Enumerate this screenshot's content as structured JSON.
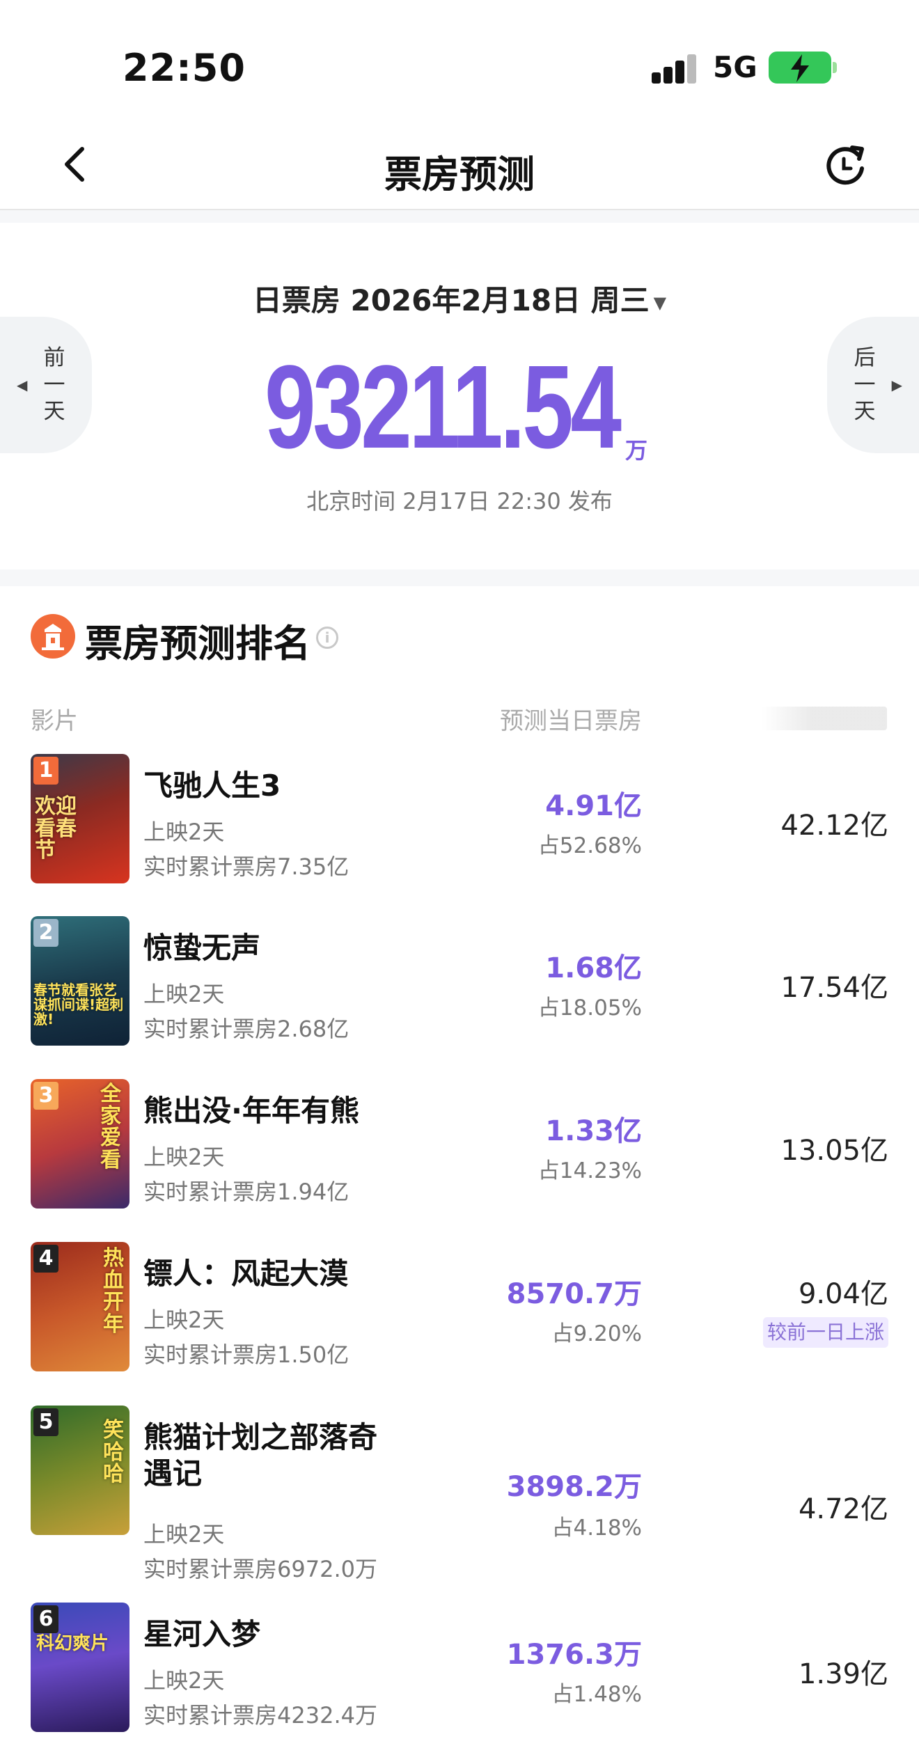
{
  "status_bar": {
    "time": "22:50",
    "network": "5G"
  },
  "nav": {
    "title": "票房预测"
  },
  "summary": {
    "date_label": "日票房 2026年2月18日 周三",
    "amount": "93211.54",
    "unit": "万",
    "publish_note": "北京时间 2月17日 22:30 发布",
    "prev_day_label": "前\n一\n天",
    "next_day_label": "后\n一\n天"
  },
  "ranking": {
    "title": "票房预测排名",
    "columns": {
      "film": "影片",
      "predicted": "预测当日票房"
    },
    "movies": [
      {
        "rank": "1",
        "title": "飞驰人生3",
        "days": "上映2天",
        "total": "实时累计票房7.35亿",
        "predicted": "4.91亿",
        "share": "占52.68%",
        "third": "42.12亿",
        "tag": ""
      },
      {
        "rank": "2",
        "title": "惊蛰无声",
        "days": "上映2天",
        "total": "实时累计票房2.68亿",
        "predicted": "1.68亿",
        "share": "占18.05%",
        "third": "17.54亿",
        "tag": ""
      },
      {
        "rank": "3",
        "title": "熊出没·年年有熊",
        "days": "上映2天",
        "total": "实时累计票房1.94亿",
        "predicted": "1.33亿",
        "share": "占14.23%",
        "third": "13.05亿",
        "tag": ""
      },
      {
        "rank": "4",
        "title": "镖人：风起大漠",
        "days": "上映2天",
        "total": "实时累计票房1.50亿",
        "predicted": "8570.7万",
        "share": "占9.20%",
        "third": "9.04亿",
        "tag": "较前一日上涨"
      },
      {
        "rank": "5",
        "title_line1": "熊猫计划之部落奇",
        "title_line2": "遇记",
        "days": "上映2天",
        "total": "实时累计票房6972.0万",
        "predicted": "3898.2万",
        "share": "占4.18%",
        "third": "4.72亿",
        "tag": ""
      },
      {
        "rank": "6",
        "title": "星河入梦",
        "days": "上映2天",
        "total": "实时累计票房4232.4万",
        "predicted": "1376.3万",
        "share": "占1.48%",
        "third": "1.39亿",
        "tag": ""
      }
    ],
    "posters": [
      {
        "text": "欢迎看春节"
      },
      {
        "text": "春节就看张艺谋抓间谍!超刺激!"
      },
      {
        "text": "全家爱看"
      },
      {
        "text": "热血开年"
      },
      {
        "text": "笑哈哈"
      },
      {
        "text": "科幻爽片"
      }
    ]
  },
  "colors": {
    "accent": "#7b5ce0",
    "rank_badge_top": "#f26b3a",
    "rank_badge_other": "#222222",
    "battery": "#34c759"
  }
}
